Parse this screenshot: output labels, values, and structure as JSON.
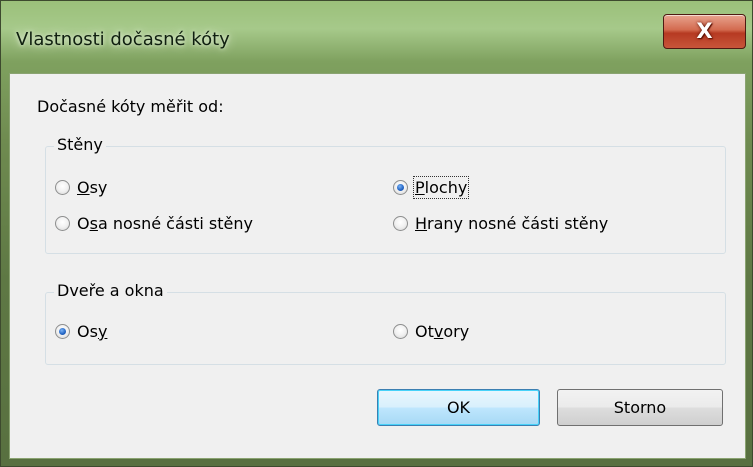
{
  "window": {
    "title": "Vlastnosti dočasné kóty",
    "close_glyph": "X"
  },
  "intro_label": "Dočasné kóty měřit od:",
  "walls": {
    "legend": "Stěny",
    "options": [
      {
        "pre": "",
        "ul": "O",
        "post": "sy",
        "checked": false
      },
      {
        "pre": "",
        "ul": "P",
        "post": "lochy",
        "checked": true
      },
      {
        "pre": "O",
        "ul": "s",
        "post": "a nosné části stěny",
        "checked": false
      },
      {
        "pre": "",
        "ul": "H",
        "post": "rany nosné části stěny",
        "checked": false
      }
    ]
  },
  "doors_windows": {
    "legend": "Dveře a okna",
    "options": [
      {
        "pre": "Os",
        "ul": "y",
        "post": "",
        "checked": true
      },
      {
        "pre": "Ot",
        "ul": "v",
        "post": "ory",
        "checked": false
      }
    ]
  },
  "buttons": {
    "ok": "OK",
    "cancel": "Storno"
  },
  "colors": {
    "frame": "#6f8b50",
    "client_bg": "#f0f0f0",
    "close_button": "#c8553a",
    "default_button": "#bee6fd"
  }
}
